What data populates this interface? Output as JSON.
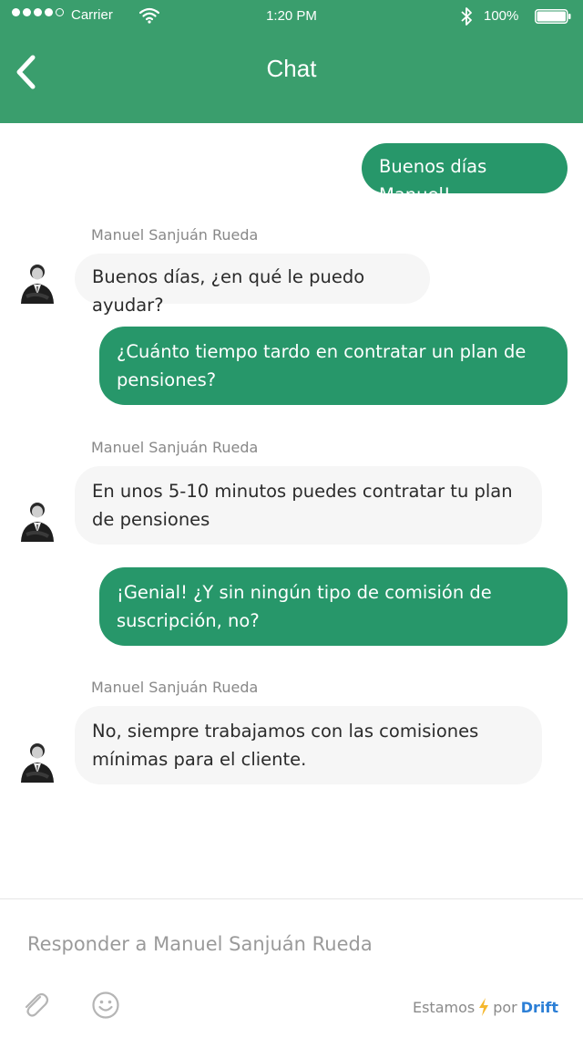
{
  "status_bar": {
    "carrier": "Carrier",
    "time": "1:20 PM",
    "battery": "100%"
  },
  "header": {
    "title": "Chat",
    "back_icon": "chevron-left-icon"
  },
  "messages": [
    {
      "direction": "out",
      "text": "Buenos días Manuel!"
    },
    {
      "direction": "in",
      "sender": "Manuel Sanjuán Rueda",
      "text": "Buenos días, ¿en qué le puedo ayudar?"
    },
    {
      "direction": "out",
      "text": "¿Cuánto tiempo tardo en contratar un plan de pensiones?"
    },
    {
      "direction": "in",
      "sender": "Manuel Sanjuán Rueda",
      "text": "En unos 5-10 minutos puedes contratar tu plan de pensiones"
    },
    {
      "direction": "out",
      "text": "¡Genial! ¿Y sin ningún tipo de comisión de suscripción, no?"
    },
    {
      "direction": "in",
      "sender": "Manuel Sanjuán Rueda",
      "text": "No, siempre trabajamos con las comisiones mínimas para el cliente."
    }
  ],
  "composer": {
    "placeholder": "Responder a Manuel Sanjuán Rueda",
    "value": "",
    "attach_icon": "paperclip-icon",
    "emoji_icon": "smiley-icon",
    "branding_prefix": "Estamos",
    "branding_icon": "lightning-icon",
    "branding_by": "por",
    "branding_name": "Drift"
  },
  "colors": {
    "header": "#3a9e6d",
    "outgoing_bubble": "#27976a",
    "incoming_bubble": "#f6f6f6",
    "brand_link": "#2c7fd6",
    "lightning": "#f5b82e"
  }
}
